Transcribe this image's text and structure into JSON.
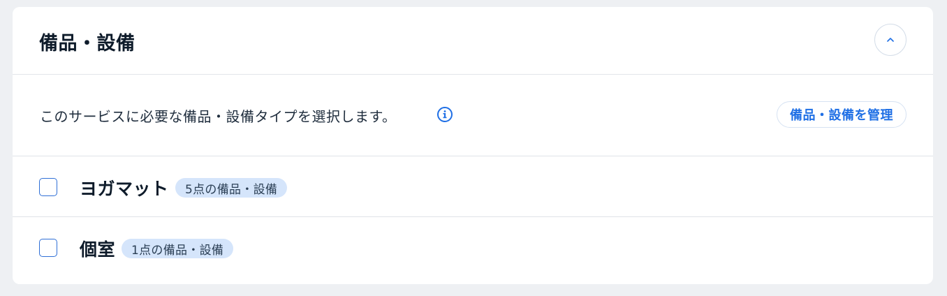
{
  "section": {
    "title": "備品・設備",
    "collapse_icon": "chevron-up-icon"
  },
  "description": {
    "text": "このサービスに必要な備品・設備タイプを選択します。",
    "info_icon": "info-icon",
    "manage_label": "備品・設備を管理"
  },
  "items": [
    {
      "name": "ヨガマット",
      "badge": "5点の備品・設備",
      "checked": false
    },
    {
      "name": "個室",
      "badge": "1点の備品・設備",
      "checked": false
    }
  ],
  "colors": {
    "accent": "#1f6fe5",
    "badge_bg": "#d5e5fb",
    "page_bg": "#eef0f3"
  }
}
